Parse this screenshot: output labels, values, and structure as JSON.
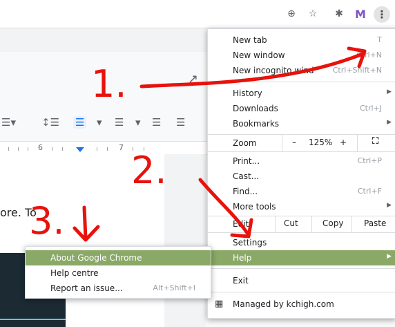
{
  "toolbar": {
    "icons": [
      "zoom-icon",
      "star-icon",
      "extensions-icon",
      "extension-m-icon",
      "three-dot-menu-icon"
    ],
    "ext_m_letter": "M",
    "menu_glyph": "⋮"
  },
  "doc": {
    "ruler_numbers": [
      "6",
      "7"
    ],
    "page_text": "ore. To"
  },
  "menu": {
    "new_tab": {
      "label": "New tab",
      "shortcut": "T"
    },
    "new_window": {
      "label": "New window",
      "shortcut": "Ctrl+N"
    },
    "new_incognito": {
      "label": "New incognito wind",
      "shortcut": "Ctrl+Shift+N"
    },
    "history": {
      "label": "History"
    },
    "downloads": {
      "label": "Downloads",
      "shortcut": "Ctrl+J"
    },
    "bookmarks": {
      "label": "Bookmarks"
    },
    "zoom": {
      "label": "Zoom",
      "minus": "–",
      "level": "125%",
      "plus": "+"
    },
    "print": {
      "label": "Print...",
      "shortcut": "Ctrl+P"
    },
    "cast": {
      "label": "Cast..."
    },
    "find": {
      "label": "Find...",
      "shortcut": "Ctrl+F"
    },
    "more_tools": {
      "label": "More tools"
    },
    "edit": {
      "label": "Edit",
      "cut": "Cut",
      "copy": "Copy",
      "paste": "Paste"
    },
    "settings": {
      "label": "Settings"
    },
    "help": {
      "label": "Help"
    },
    "exit": {
      "label": "Exit"
    },
    "managed": {
      "label": "Managed by kchigh.com"
    }
  },
  "help_submenu": {
    "about": {
      "label": "About Google Chrome"
    },
    "help_centre": {
      "label": "Help centre"
    },
    "report": {
      "label": "Report an issue...",
      "shortcut": "Alt+Shift+I"
    }
  },
  "annotations": {
    "step_1": "1.",
    "step_2": "2.",
    "step_3": "3.",
    "color": "#e8120c"
  },
  "colors": {
    "highlight": "#8aa866",
    "menu_border": "#dadce0"
  }
}
